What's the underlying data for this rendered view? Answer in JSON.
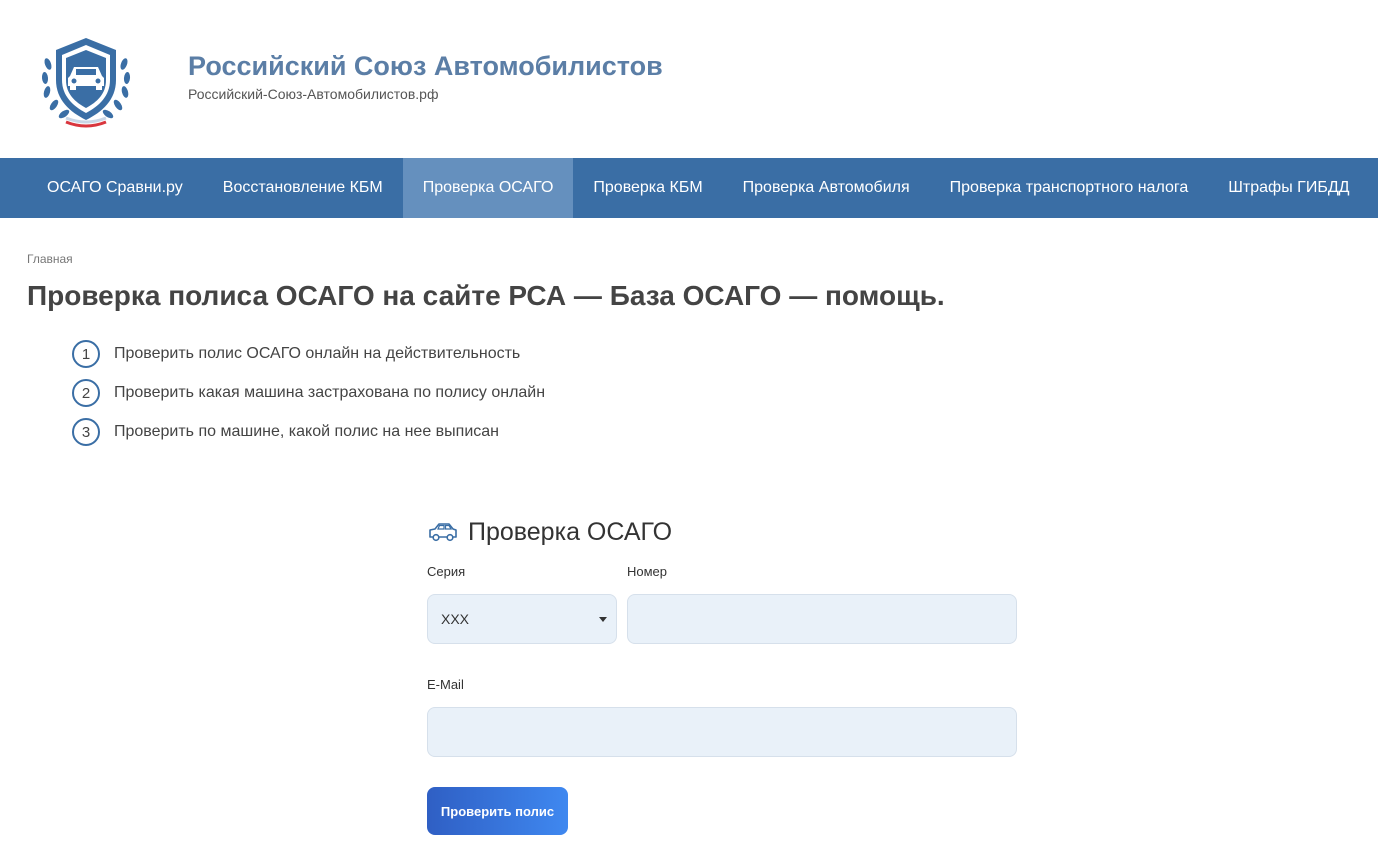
{
  "site": {
    "title": "Российский Союз Автомобилистов",
    "subtitle": "Российский-Союз-Автомобилистов.рф",
    "logo_icon": "shield-car-emblem-icon"
  },
  "nav": {
    "items": [
      {
        "label": "ОСАГО Сравни.ру",
        "active": false
      },
      {
        "label": "Восстановление КБМ",
        "active": false
      },
      {
        "label": "Проверка ОСАГО",
        "active": true
      },
      {
        "label": "Проверка КБМ",
        "active": false
      },
      {
        "label": "Проверка Автомобиля",
        "active": false
      },
      {
        "label": "Проверка транспортного налога",
        "active": false
      },
      {
        "label": "Штрафы ГИБДД",
        "active": false
      }
    ]
  },
  "breadcrumb": {
    "home": "Главная"
  },
  "page": {
    "title": "Проверка полиса ОСАГО на сайте РСА — База ОСАГО — помощь."
  },
  "steps": [
    {
      "num": "1",
      "text": "Проверить полис ОСАГО онлайн на действительность"
    },
    {
      "num": "2",
      "text": "Проверить какая машина застрахована по полису онлайн"
    },
    {
      "num": "3",
      "text": "Проверить по машине, какой полис на нее выписан"
    }
  ],
  "form": {
    "title": "Проверка ОСАГО",
    "icon": "car-icon",
    "series_label": "Серия",
    "series_value": "XXX",
    "number_label": "Номер",
    "number_value": "",
    "email_label": "E-Mail",
    "email_value": "",
    "submit_label": "Проверить полис"
  },
  "colors": {
    "brand": "#3a6ea5",
    "nav_active": "#6590be",
    "title_blue": "#5b7ea6",
    "field_bg": "#e9f1f9",
    "button_start": "#2f5fc4",
    "button_end": "#3f88f0"
  }
}
